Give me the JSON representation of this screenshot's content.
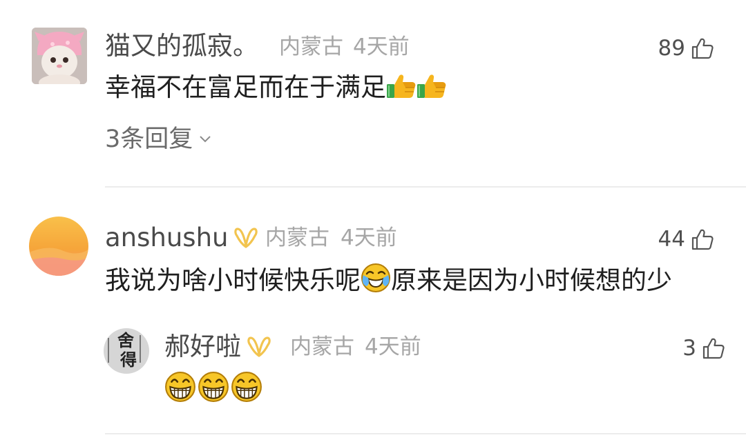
{
  "comments": [
    {
      "username": "猫又的孤寂。",
      "location": "内蒙古",
      "time": "4天前",
      "likes": "89",
      "text": "幸福不在富足而在于满足",
      "emoji_icons": [
        "thumbs-up-icon",
        "thumbs-up-icon"
      ],
      "replies_label": "3条回复"
    },
    {
      "username": "anshushu",
      "badge": "vip-badge-icon",
      "location": "内蒙古",
      "time": "4天前",
      "likes": "44",
      "text_before": "我说为啥小时候快乐呢",
      "inline_emoji": "crying-laughing-icon",
      "text_after": "原来是因为小时候想的少",
      "reply": {
        "username": "郝好啦",
        "badge": "vip-badge-icon",
        "avatar_text": [
          "舍",
          "得"
        ],
        "location": "内蒙古",
        "time": "4天前",
        "likes": "3",
        "emoji_icons": [
          "grinning-icon",
          "grinning-icon",
          "grinning-icon"
        ]
      }
    }
  ],
  "colors": {
    "username": "#4a4a4a",
    "meta": "#a6a6a6",
    "text": "#1f1f1f",
    "badge": "#f2c44f",
    "divider": "#ececec"
  }
}
